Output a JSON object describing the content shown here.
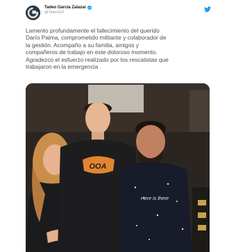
{
  "author": {
    "name": "Tadeo García Zalazar",
    "handle": "@TadeoGZ",
    "avatar_icon": "g-logo-icon",
    "verified_icon": "verified-badge-icon"
  },
  "platform_icon": "twitter-bird-icon",
  "tweet": {
    "lines": [
      "Lamento profundamente el fallecimiento del querido",
      "Darío Palma, comprometido militante y colaborador de",
      "la gestión. Acompaño a su familia, amigos y",
      "compañeros de trabajo en este doloroso momento.",
      "Agradezco el esfuerzo realizado por los rescatistas que",
      "trabajaron en la emergencia"
    ]
  },
  "photo": {
    "shirt_center_text": "OOA",
    "shirt_right_text": "Here is there"
  },
  "colors": {
    "accent_blue": "#1d9bf0",
    "text": "#4a4f54"
  }
}
